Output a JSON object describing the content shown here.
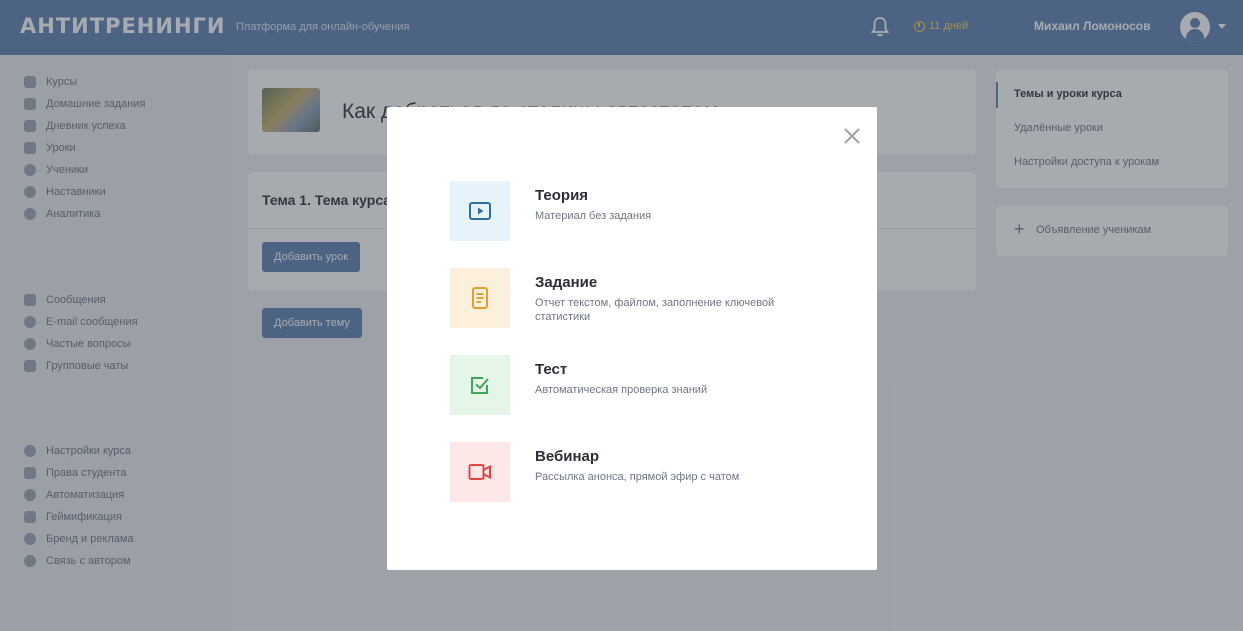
{
  "header": {
    "logo": "АНТИТРЕНИНГИ",
    "tagline": "Платформа для онлайн-обучения",
    "trial": "11 дней",
    "user_name": "Михаил Ломоносов"
  },
  "sidebar": {
    "groups": [
      [
        {
          "label": "Курсы",
          "icon": "courses-icon"
        },
        {
          "label": "Домашние задания",
          "icon": "homework-icon"
        },
        {
          "label": "Дневник успеха",
          "icon": "diary-icon"
        },
        {
          "label": "Уроки",
          "icon": "lessons-icon"
        },
        {
          "label": "Ученики",
          "icon": "students-icon"
        },
        {
          "label": "Наставники",
          "icon": "mentors-icon"
        },
        {
          "label": "Аналитика",
          "icon": "analytics-icon"
        }
      ],
      [
        {
          "label": "Сообщения",
          "icon": "messages-icon"
        },
        {
          "label": "E-mail сообщения",
          "icon": "email-icon"
        },
        {
          "label": "Частые вопросы",
          "icon": "faq-icon"
        },
        {
          "label": "Групповые чаты",
          "icon": "group-chats-icon"
        }
      ],
      [
        {
          "label": "Настройки курса",
          "icon": "gear-icon"
        },
        {
          "label": "Права студента",
          "icon": "student-rights-icon"
        },
        {
          "label": "Автоматизация",
          "icon": "automation-icon"
        },
        {
          "label": "Геймификация",
          "icon": "gamification-icon"
        },
        {
          "label": "Бренд и реклама",
          "icon": "brand-icon"
        },
        {
          "label": "Связь с автором",
          "icon": "contact-author-icon"
        }
      ]
    ]
  },
  "main": {
    "course_title": "Как добраться до столицы автостопом",
    "topic_title": "Тема 1. Тема курса",
    "add_lesson": "Добавить урок",
    "add_topic": "Добавить тему"
  },
  "right_panel": {
    "links": [
      "Темы и уроки курса",
      "Удалённые уроки",
      "Настройки доступа к урокам"
    ],
    "announce": "Объявление ученикам"
  },
  "modal": {
    "options": [
      {
        "title": "Теория",
        "desc": "Материал без задания",
        "icon": "play-icon",
        "bg": "#e6f3fb",
        "color": "#2f6fa0"
      },
      {
        "title": "Задание",
        "desc": "Отчет текстом, файлом, заполнение ключевой статистики",
        "icon": "document-icon",
        "bg": "#fcf0dc",
        "color": "#e0a030"
      },
      {
        "title": "Тест",
        "desc": "Автоматическая проверка знаний",
        "icon": "checkbox-icon",
        "bg": "#e5f6e8",
        "color": "#3ea65a"
      },
      {
        "title": "Вебинар",
        "desc": "Рассылка анонса, прямой эфир с чатом",
        "icon": "video-icon",
        "bg": "#fde7e7",
        "color": "#e04848"
      }
    ]
  }
}
